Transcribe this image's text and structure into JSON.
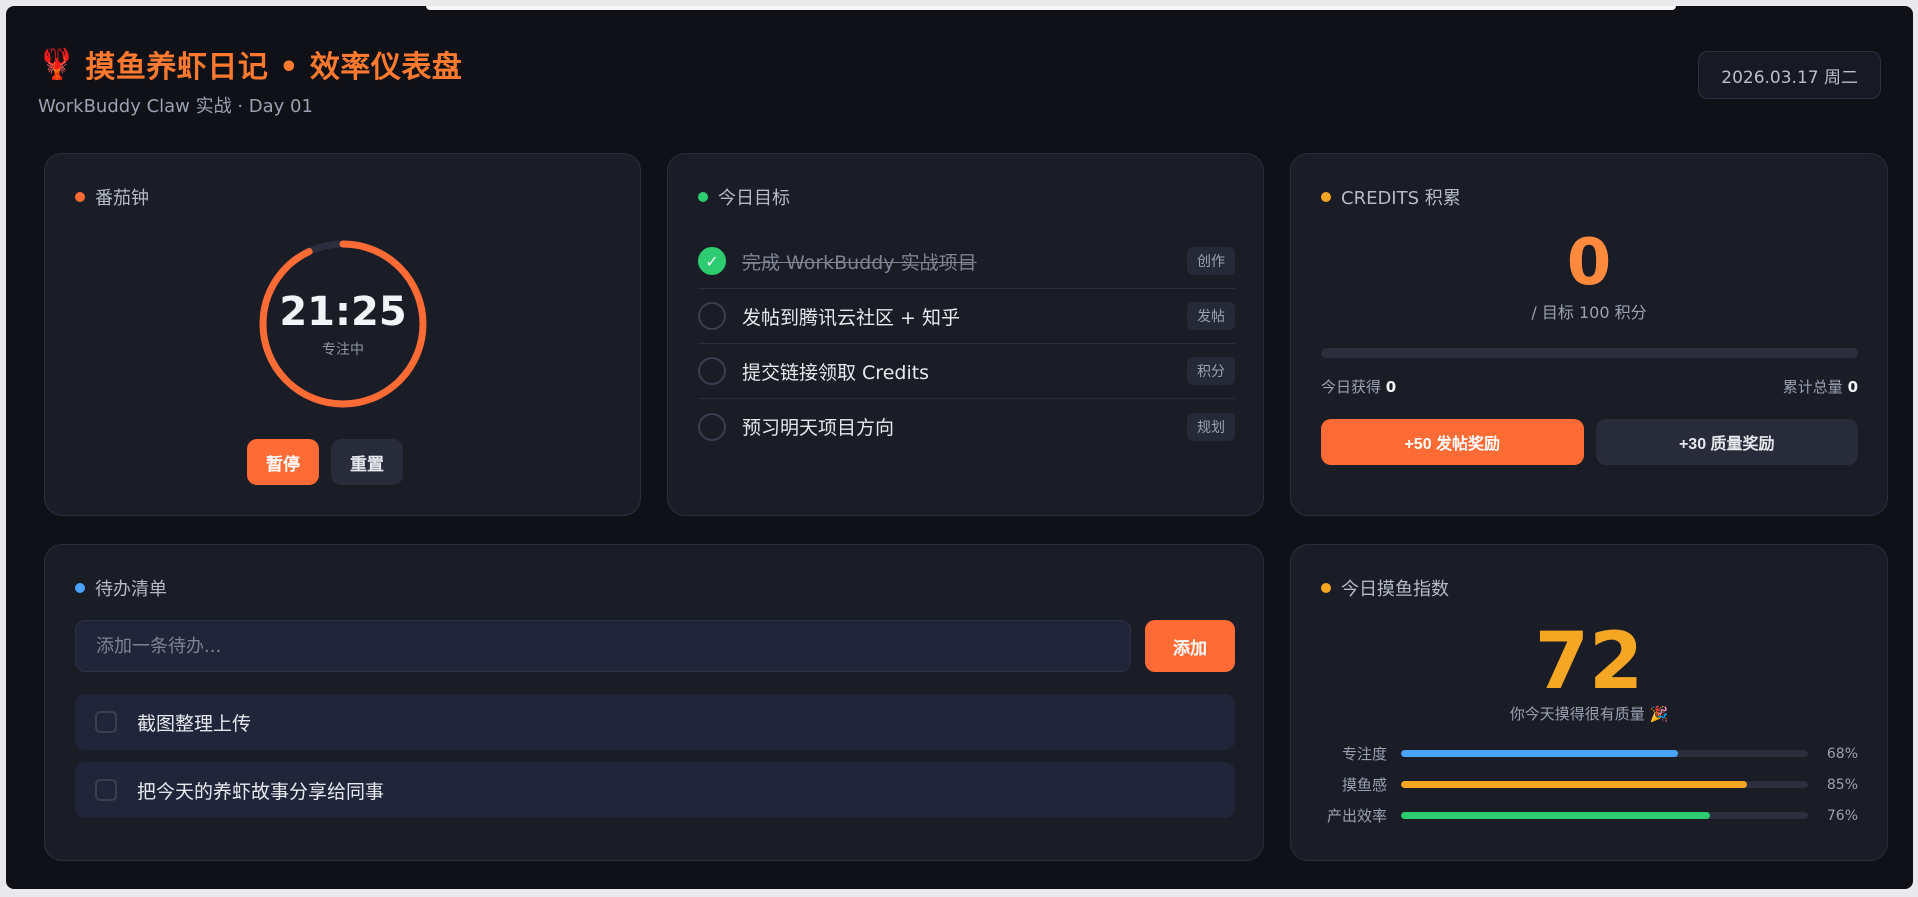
{
  "header": {
    "emoji": "🦞",
    "title": "摸鱼养虾日记 • 效率仪表盘",
    "subtitle": "WorkBuddy Claw 实战 · Day 01",
    "date": "2026.03.17  周二"
  },
  "pomodoro": {
    "title": "番茄钟",
    "dot_color": "#ff6b35",
    "time": "21:25",
    "status": "专注中",
    "progress": 0.93,
    "pause_label": "暂停",
    "reset_label": "重置"
  },
  "goals": {
    "title": "今日目标",
    "dot_color": "#2ecc71",
    "items": [
      {
        "text": "完成 WorkBuddy 实战项目",
        "tag": "创作",
        "done": true
      },
      {
        "text": "发帖到腾讯云社区 + 知乎",
        "tag": "发帖",
        "done": false
      },
      {
        "text": "提交链接领取 Credits",
        "tag": "积分",
        "done": false
      },
      {
        "text": "预习明天项目方向",
        "tag": "规划",
        "done": false
      }
    ]
  },
  "credits": {
    "title": "CREDITS 积累",
    "dot_color": "#f5a623",
    "value": "0",
    "goal_text": "/ 目标 100 积分",
    "progress": 0,
    "today_label": "今日获得",
    "today_value": "0",
    "total_label": "累计总量",
    "total_value": "0",
    "btn_post": "+50 发帖奖励",
    "btn_quality": "+30 质量奖励"
  },
  "todo": {
    "title": "待办清单",
    "dot_color": "#4aa3ff",
    "placeholder": "添加一条待办...",
    "add_label": "添加",
    "items": [
      {
        "text": "截图整理上传"
      },
      {
        "text": "把今天的养虾故事分享给同事"
      }
    ]
  },
  "fishing": {
    "title": "今日摸鱼指数",
    "dot_color": "#f5a623",
    "value": "72",
    "message": "你今天摸得很有质量 🎉",
    "metrics": [
      {
        "label": "专注度",
        "pct": "68%",
        "value": 0.68,
        "color": "#4aa3ff"
      },
      {
        "label": "摸鱼感",
        "pct": "85%",
        "value": 0.85,
        "color": "#f5a623"
      },
      {
        "label": "产出效率",
        "pct": "76%",
        "value": 0.76,
        "color": "#2ecc71"
      }
    ]
  }
}
